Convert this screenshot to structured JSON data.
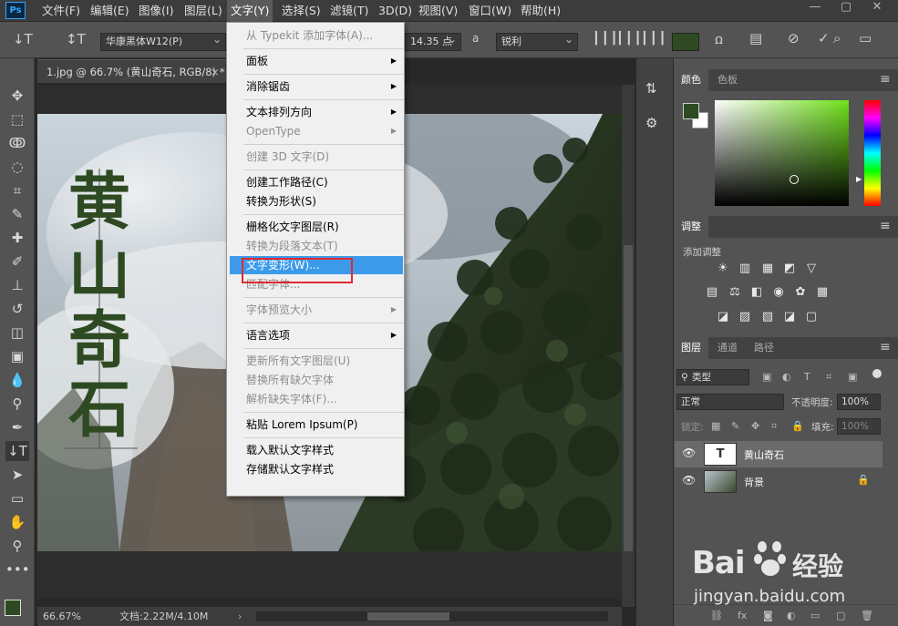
{
  "app": {
    "logo": "Ps"
  },
  "menubar": {
    "items": [
      "文件(F)",
      "编辑(E)",
      "图像(I)",
      "图层(L)",
      "文字(Y)",
      "选择(S)",
      "滤镜(T)",
      "3D(D)",
      "视图(V)",
      "窗口(W)",
      "帮助(H)"
    ],
    "active_index": 4
  },
  "options_bar": {
    "tool_icon": "vertical-type-icon",
    "font_family": "华康黑体W12(P)",
    "font_size": "14.35 点",
    "aa_label": "a",
    "antialias": "锐利",
    "text_color": "#2f4a23"
  },
  "document": {
    "tab_title": "1.jpg @ 66.7% (黄山奇石, RGB/8) *",
    "tab_close": "×",
    "artwork_text": [
      "黄",
      "山",
      "奇",
      "石"
    ],
    "artwork_text_color": "#2e4a22",
    "zoom": "66.67%",
    "doc_info": "文档:2.22M/4.10M"
  },
  "dropdown": {
    "items": [
      {
        "label": "从 Typekit 添加字体(A)...",
        "disabled": true
      },
      {
        "sep": true
      },
      {
        "label": "面板",
        "submenu": true
      },
      {
        "sep": true
      },
      {
        "label": "消除锯齿",
        "submenu": true
      },
      {
        "sep": true
      },
      {
        "label": "文本排列方向",
        "submenu": true
      },
      {
        "label": "OpenType",
        "submenu": true,
        "disabled": true
      },
      {
        "sep": true
      },
      {
        "label": "创建 3D 文字(D)",
        "disabled": true
      },
      {
        "sep": true
      },
      {
        "label": "创建工作路径(C)"
      },
      {
        "label": "转换为形状(S)"
      },
      {
        "sep": true
      },
      {
        "label": "栅格化文字图层(R)"
      },
      {
        "label": "转换为段落文本(T)",
        "disabled": true
      },
      {
        "label": "文字变形(W)...",
        "highlight": true
      },
      {
        "label": "匹配字体...",
        "disabled": true
      },
      {
        "sep": true
      },
      {
        "label": "字体预览大小",
        "submenu": true,
        "disabled": true
      },
      {
        "sep": true
      },
      {
        "label": "语言选项",
        "submenu": true
      },
      {
        "sep": true
      },
      {
        "label": "更新所有文字图层(U)",
        "disabled": true
      },
      {
        "label": "替换所有缺欠字体",
        "disabled": true
      },
      {
        "label": "解析缺失字体(F)...",
        "disabled": true
      },
      {
        "sep": true
      },
      {
        "label": "粘贴 Lorem Ipsum(P)"
      },
      {
        "sep": true
      },
      {
        "label": "载入默认文字样式"
      },
      {
        "label": "存储默认文字样式"
      }
    ]
  },
  "color_panel": {
    "tabs": [
      "颜色",
      "色板"
    ],
    "fg": "#2d4a22",
    "bg": "#ffffff"
  },
  "adjust_panel": {
    "tab": "调整",
    "subtitle": "添加调整"
  },
  "layers_panel": {
    "tabs": [
      "图层",
      "通道",
      "路径"
    ],
    "filter_label": "类型",
    "blend_mode": "正常",
    "opacity_label": "不透明度:",
    "opacity": "100%",
    "lock_label": "锁定:",
    "fill_label": "填充:",
    "fill": "100%",
    "layers": [
      {
        "name": "黄山奇石",
        "type": "text",
        "thumb": "T",
        "selected": true
      },
      {
        "name": "背景",
        "type": "image",
        "locked": true
      }
    ]
  },
  "watermark": {
    "brand": "Bai",
    "brand2": "经验",
    "url": "jingyan.baidu.com"
  },
  "colors": {
    "accent": "#3b9bea",
    "annotation": "#e3292e",
    "panel": "#535353"
  }
}
